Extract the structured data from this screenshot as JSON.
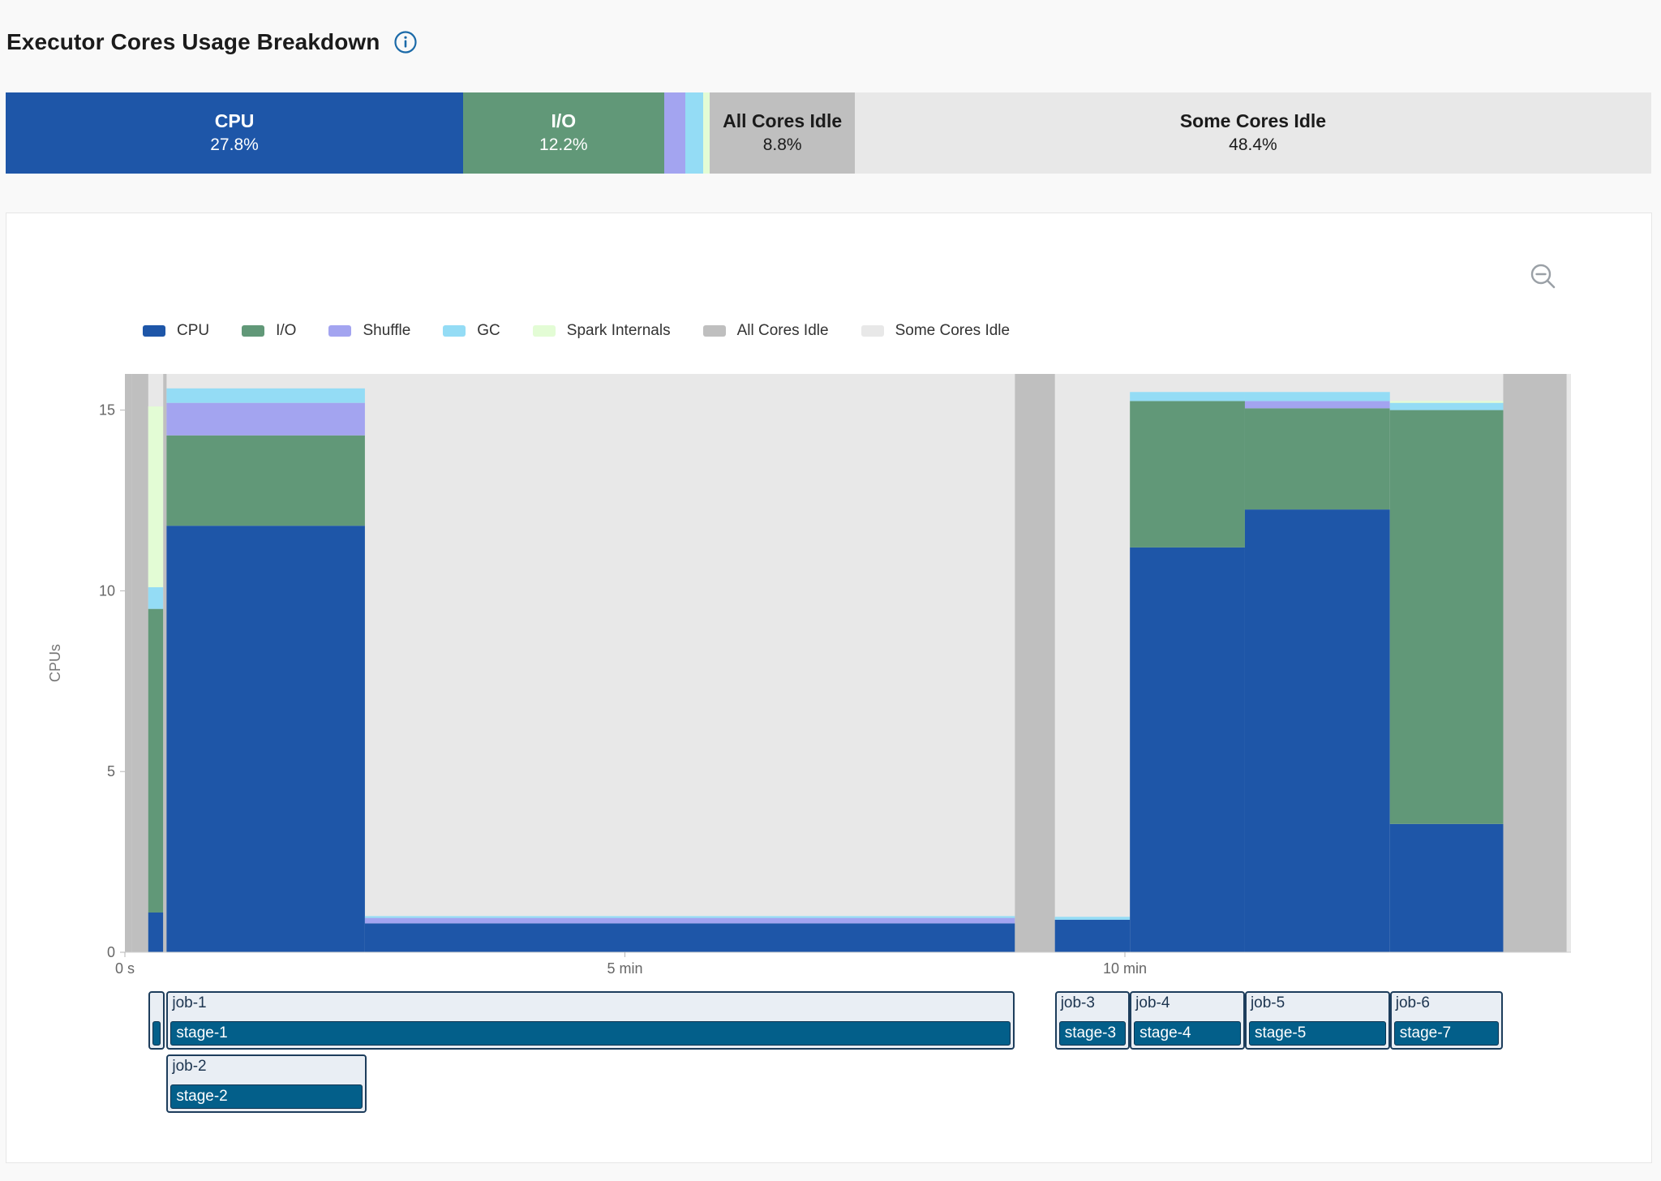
{
  "header": {
    "title": "Executor Cores Usage Breakdown",
    "info_icon": "info-circle-icon"
  },
  "summary": {
    "segments": [
      {
        "key": "cpu",
        "label": "CPU",
        "value": "27.8%",
        "percent": 27.8,
        "color": "#1e56a8",
        "style": "dark"
      },
      {
        "key": "io",
        "label": "I/O",
        "value": "12.2%",
        "percent": 12.2,
        "color": "#619878",
        "style": "dark"
      },
      {
        "key": "shuffle",
        "label": "",
        "value": "",
        "percent": 1.3,
        "color": "#a3a4f0",
        "style": "dark"
      },
      {
        "key": "gc",
        "label": "",
        "value": "",
        "percent": 1.1,
        "color": "#94dcf5",
        "style": "dark"
      },
      {
        "key": "internals",
        "label": "",
        "value": "",
        "percent": 0.4,
        "color": "#e3fcd5",
        "style": "light"
      },
      {
        "key": "all_idle",
        "label": "All Cores Idle",
        "value": "8.8%",
        "percent": 8.8,
        "color": "#bfbfbf",
        "style": "light"
      },
      {
        "key": "some_idle",
        "label": "Some Cores Idle",
        "value": "48.4%",
        "percent": 48.4,
        "color": "#e8e8e8",
        "style": "light"
      }
    ]
  },
  "zoom_icon": "zoom-out-icon",
  "legend": [
    {
      "label": "CPU",
      "color": "#1e56a8"
    },
    {
      "label": "I/O",
      "color": "#619878"
    },
    {
      "label": "Shuffle",
      "color": "#a3a4f0"
    },
    {
      "label": "GC",
      "color": "#94dcf5"
    },
    {
      "label": "Spark Internals",
      "color": "#e3fcd5"
    },
    {
      "label": "All Cores Idle",
      "color": "#bfbfbf"
    },
    {
      "label": "Some Cores Idle",
      "color": "#e8e8e8"
    }
  ],
  "chart_data": {
    "type": "area",
    "title": "",
    "xlabel": "",
    "ylabel": "CPUs",
    "x_unit": "seconds",
    "xlim": [
      0,
      818
    ],
    "ylim": [
      0,
      16
    ],
    "y_ticks": [
      0,
      5,
      10,
      15
    ],
    "x_ticks": [
      {
        "value": 0,
        "label": "0 s"
      },
      {
        "value": 300,
        "label": "5 min"
      },
      {
        "value": 600,
        "label": "10 min"
      }
    ],
    "grid": false,
    "legend_position": "top-left",
    "series_order": [
      "cpu",
      "io",
      "shuffle",
      "gc",
      "internals"
    ],
    "colors": {
      "cpu": "#1e56a8",
      "io": "#619878",
      "shuffle": "#a3a4f0",
      "gc": "#94dcf5",
      "internals": "#e3fcd5",
      "all_idle": "#bfbfbf",
      "some_idle": "#e8e8e8"
    },
    "intervals": [
      {
        "start": 0,
        "end": 4,
        "all_idle": true
      },
      {
        "start": 4,
        "end": 14,
        "all_idle": true
      },
      {
        "start": 14,
        "end": 23,
        "cpu": 1.1,
        "io": 8.4,
        "shuffle": 0,
        "gc": 0.6,
        "internals": 5.0
      },
      {
        "start": 23,
        "end": 25,
        "all_idle": true
      },
      {
        "start": 25,
        "end": 144,
        "cpu": 11.8,
        "io": 2.5,
        "shuffle": 0.9,
        "gc": 0.4,
        "internals": 0
      },
      {
        "start": 144,
        "end": 534,
        "cpu": 0.8,
        "io": 0,
        "shuffle": 0.15,
        "gc": 0.05,
        "internals": 0
      },
      {
        "start": 534,
        "end": 558,
        "all_idle": true
      },
      {
        "start": 558,
        "end": 603,
        "cpu": 0.9,
        "io": 0,
        "shuffle": 0,
        "gc": 0.08,
        "internals": 0
      },
      {
        "start": 603,
        "end": 672,
        "cpu": 11.2,
        "io": 4.05,
        "shuffle": 0,
        "gc": 0.25,
        "internals": 0
      },
      {
        "start": 672,
        "end": 759,
        "cpu": 12.25,
        "io": 2.8,
        "shuffle": 0.2,
        "gc": 0.25,
        "internals": 0
      },
      {
        "start": 759,
        "end": 827,
        "cpu": 3.55,
        "io": 11.45,
        "shuffle": 0,
        "gc": 0.2,
        "internals": 0.05
      },
      {
        "start": 827,
        "end": 865,
        "all_idle": true
      }
    ]
  },
  "jobs": [
    {
      "start": 14,
      "end": 24,
      "row": 0,
      "job": "",
      "stage": ""
    },
    {
      "start": 25,
      "end": 534,
      "row": 0,
      "job": "job-1",
      "stage": "stage-1"
    },
    {
      "start": 25,
      "end": 145,
      "row": 1,
      "job": "job-2",
      "stage": "stage-2"
    },
    {
      "start": 558,
      "end": 603,
      "row": 0,
      "job": "job-3",
      "stage": "stage-3"
    },
    {
      "start": 603,
      "end": 672,
      "row": 0,
      "job": "job-4",
      "stage": "stage-4"
    },
    {
      "start": 672,
      "end": 759,
      "row": 0,
      "job": "job-5",
      "stage": "stage-5"
    },
    {
      "start": 759,
      "end": 827,
      "row": 0,
      "job": "job-6",
      "stage": "stage-7"
    }
  ]
}
